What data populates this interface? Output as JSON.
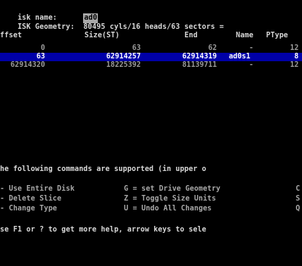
{
  "header": {
    "disk_name_label": "isk name:",
    "disk_name_value": "ad0",
    "geometry_label": "ISK Geometry:",
    "geometry_value": "80495 cyls/16 heads/63 sectors ="
  },
  "table": {
    "columns": [
      "ffset",
      "Size(ST)",
      "End",
      "Name",
      "PType"
    ],
    "rows": [
      {
        "offset": "0",
        "size": "63",
        "end": "62",
        "name": "-",
        "ptype": "12"
      },
      {
        "offset": "63",
        "size": "62914257",
        "end": "62914319",
        "name": "ad0s1",
        "ptype": "8"
      },
      {
        "offset": "62914320",
        "size": "18225392",
        "end": "81139711",
        "name": "-",
        "ptype": "12"
      }
    ],
    "selected_index": 1
  },
  "commands": {
    "intro": "he following commands are supported (in upper o",
    "col1": [
      "- Use Entire Disk",
      "- Delete Slice",
      "- Change Type"
    ],
    "col2": [
      "G = set Drive Geometry",
      "Z = Toggle Size Units",
      "U = Undo All Changes"
    ],
    "col3": [
      "C",
      "S",
      "Q"
    ]
  },
  "help": "se F1 or ? to get more help, arrow keys to sele"
}
